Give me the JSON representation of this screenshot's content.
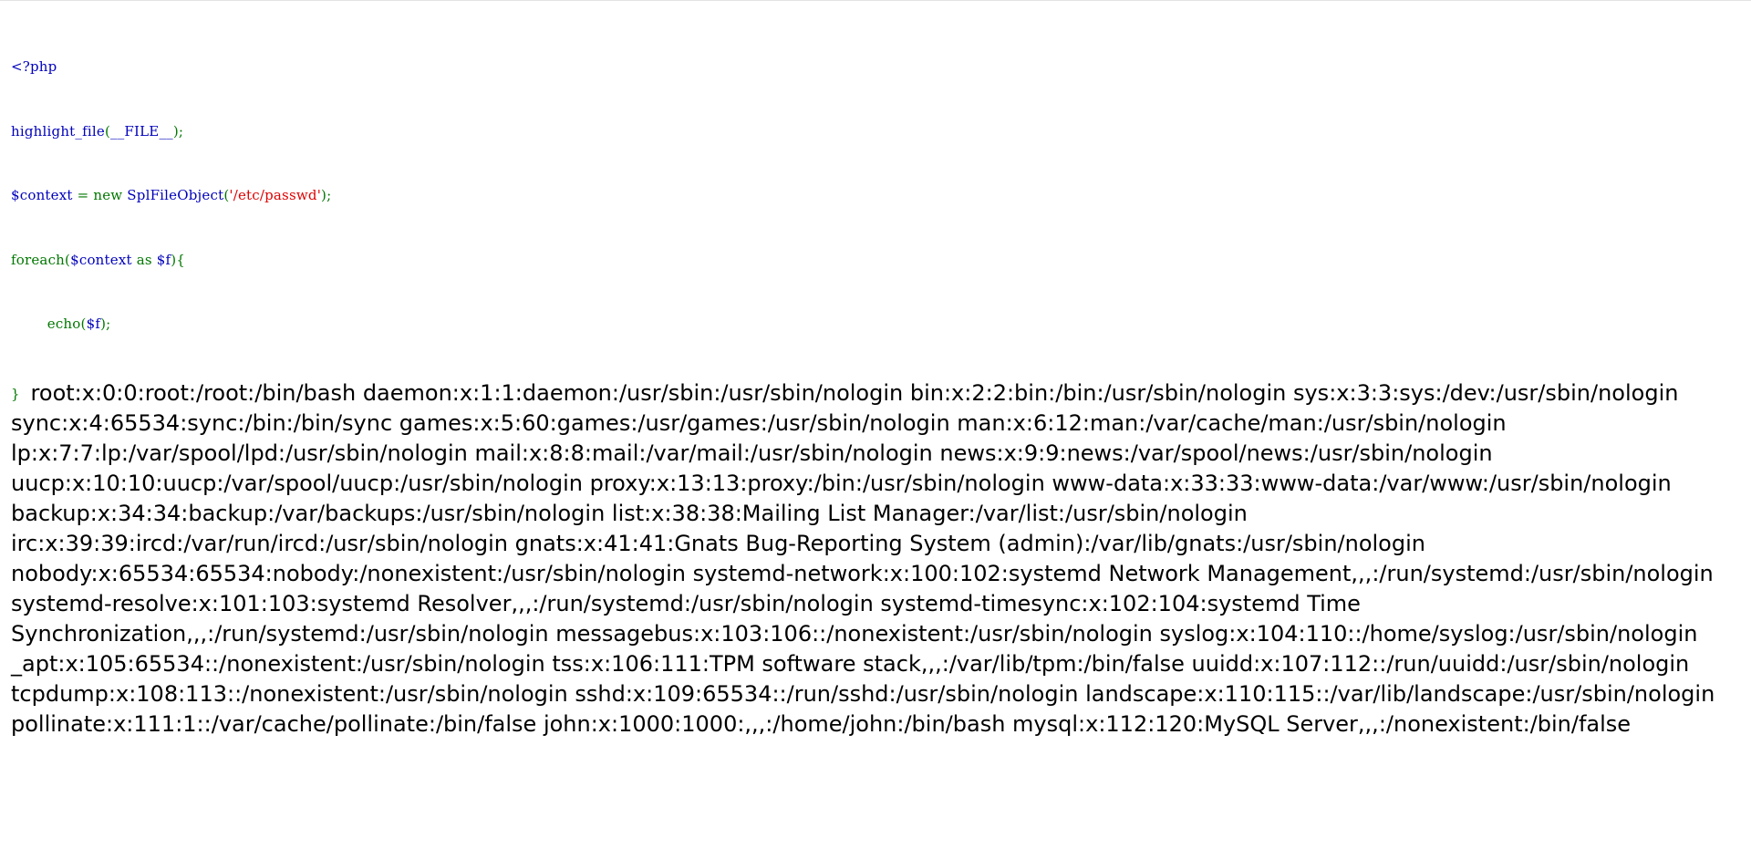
{
  "source": {
    "open_tag": "<?php",
    "line2_fn": "highlight_file",
    "line2_paren_open": "(",
    "line2_const": "__FILE__",
    "line2_end": ");",
    "line3_var": "$context",
    "line3_assign": " = new ",
    "line3_class": "SplFileObject",
    "line3_paren": "(",
    "line3_string": "'/etc/passwd'",
    "line3_end": ");",
    "line4_kw": "foreach(",
    "line4_var": "$context",
    "line4_as": " as ",
    "line4_var2": "$f",
    "line4_end": "){",
    "line5_indent_kw": "        echo(",
    "line5_var": "$f",
    "line5_end": ");",
    "closing_brace": "}"
  },
  "output": {
    "lines": [
      "root:x:0:0:root:/root:/bin/bash daemon:x:1:1:daemon:/usr/sbin:/usr/sbin/nologin bin:x:2:2:bin:/bin:/usr/sbin/nologin sys:x:3:3:sys:/dev:/usr/sbin/nologin",
      "sync:x:4:65534:sync:/bin:/bin/sync games:x:5:60:games:/usr/games:/usr/sbin/nologin man:x:6:12:man:/var/cache/man:/usr/sbin/nologin",
      "lp:x:7:7:lp:/var/spool/lpd:/usr/sbin/nologin mail:x:8:8:mail:/var/mail:/usr/sbin/nologin news:x:9:9:news:/var/spool/news:/usr/sbin/nologin",
      "uucp:x:10:10:uucp:/var/spool/uucp:/usr/sbin/nologin proxy:x:13:13:proxy:/bin:/usr/sbin/nologin www-data:x:33:33:www-data:/var/www:/usr/sbin/nologin",
      "backup:x:34:34:backup:/var/backups:/usr/sbin/nologin list:x:38:38:Mailing List Manager:/var/list:/usr/sbin/nologin",
      "irc:x:39:39:ircd:/var/run/ircd:/usr/sbin/nologin gnats:x:41:41:Gnats Bug-Reporting System (admin):/var/lib/gnats:/usr/sbin/nologin",
      "nobody:x:65534:65534:nobody:/nonexistent:/usr/sbin/nologin systemd-network:x:100:102:systemd Network Management,,,:/run/systemd:/usr/sbin/nologin",
      "systemd-resolve:x:101:103:systemd Resolver,,,:/run/systemd:/usr/sbin/nologin systemd-timesync:x:102:104:systemd Time",
      "Synchronization,,,:/run/systemd:/usr/sbin/nologin messagebus:x:103:106::/nonexistent:/usr/sbin/nologin syslog:x:104:110::/home/syslog:/usr/sbin/nologin",
      "_apt:x:105:65534::/nonexistent:/usr/sbin/nologin tss:x:106:111:TPM software stack,,,:/var/lib/tpm:/bin/false uuidd:x:107:112::/run/uuidd:/usr/sbin/nologin",
      "tcpdump:x:108:113::/nonexistent:/usr/sbin/nologin sshd:x:109:65534::/run/sshd:/usr/sbin/nologin landscape:x:110:115::/var/lib/landscape:/usr/sbin/nologin",
      "pollinate:x:111:1::/var/cache/pollinate:/bin/false john:x:1000:1000:,,,:/home/john:/bin/bash mysql:x:112:120:MySQL Server,,,:/nonexistent:/bin/false"
    ]
  },
  "colors": {
    "default": "#0000BB",
    "keyword": "#007700",
    "string": "#DD0000",
    "output_text": "#000000"
  }
}
